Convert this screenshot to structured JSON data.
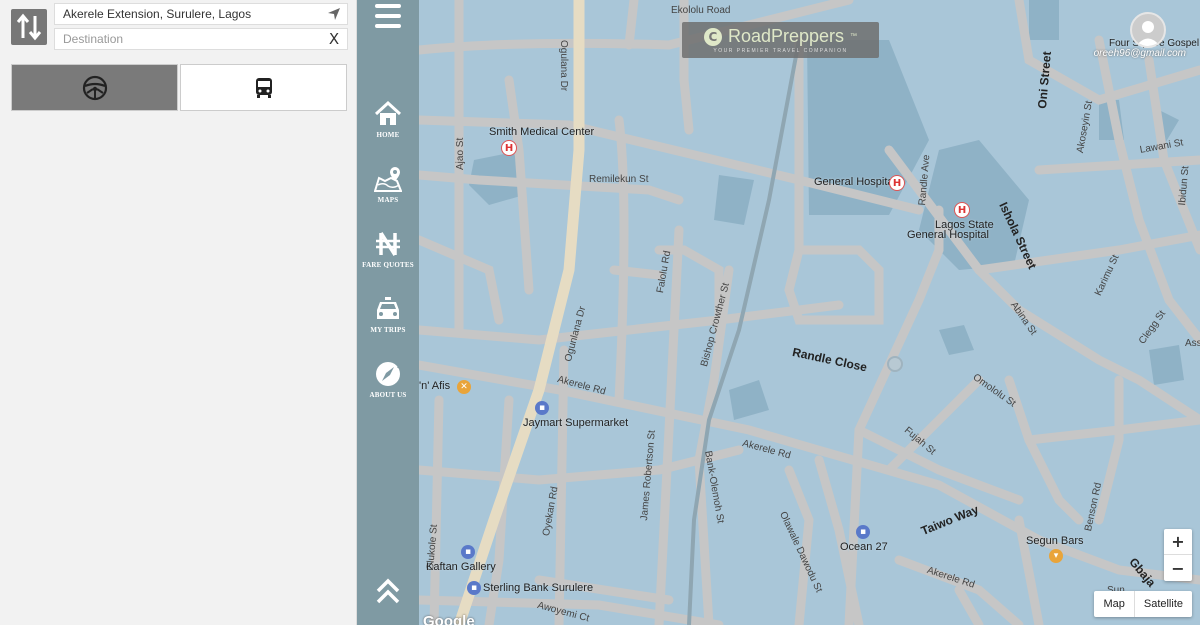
{
  "route": {
    "origin_value": "Akerele Extension, Surulere, Lagos",
    "destination_placeholder": "Destination",
    "clear_label": "X"
  },
  "modes": [
    {
      "icon": "steering-wheel-icon",
      "active": true
    },
    {
      "icon": "bus-icon",
      "active": false
    }
  ],
  "nav": {
    "items": [
      {
        "label": "HOME",
        "icon": "home-icon"
      },
      {
        "label": "MAPS",
        "icon": "map-pin-icon"
      },
      {
        "label": "FARE QUOTES",
        "icon": "naira-icon"
      },
      {
        "label": "MY TRIPS",
        "icon": "taxi-icon"
      },
      {
        "label": "ABOUT US",
        "icon": "compass-logo-icon"
      }
    ]
  },
  "brand": {
    "name": "RoadPreppers",
    "trademark": "™",
    "tagline": "YOUR PREMIER TRAVEL COMPANION"
  },
  "user": {
    "email": "oreeh96@gmail.com"
  },
  "map": {
    "pois": [
      {
        "label": "Smith Medical Center",
        "kind": "hospital"
      },
      {
        "label": "General Hospital",
        "kind": "hospital"
      },
      {
        "label": "Lagos State",
        "kind": "hospital"
      },
      {
        "label": "General Hospital",
        "kind": "hospital-line2"
      },
      {
        "label": "'n' Afis",
        "kind": "restaurant"
      },
      {
        "label": "Jaymart Supermarket",
        "kind": "shop"
      },
      {
        "label": "Ocean 27",
        "kind": "place"
      },
      {
        "label": "Kaftan Gallery",
        "kind": "shop"
      },
      {
        "label": "Sterling Bank Surulere",
        "kind": "bank"
      },
      {
        "label": "Segun Bars",
        "kind": "bar"
      },
      {
        "label": "Four Square Gospel Church",
        "kind": "church"
      }
    ],
    "streets": [
      "Ekololu Road",
      "Ogulana Dr",
      "Ogunlana Dr",
      "Remilekun St",
      "Ajao St",
      "Falolu Rd",
      "Bishop Crowther St",
      "Randle Ave",
      "Randle Close",
      "Ishola Street",
      "Oni Street",
      "Akoseyin St",
      "Lawani St",
      "Ibidun St",
      "Abina St",
      "Karimu St",
      "Clegg St",
      "Omololu St",
      "Akerele Rd",
      "Fujah St",
      "Taiwo Way",
      "Benson Rd",
      "James Robertson St",
      "Bank-Olemoh St",
      "Olawale Dawodu St",
      "Oyekan Rd",
      "Olukole St",
      "Awoyemi Ct",
      "Gbaja",
      "Ass",
      "Sun"
    ],
    "zoom_in": "+",
    "zoom_out": "−",
    "type_map": "Map",
    "type_satellite": "Satellite",
    "attribution": "Google"
  },
  "colors": {
    "map_water": "#a9c6d8",
    "rail": "#7f9aa3",
    "road": "#c8c8c8",
    "major_road": "#e6dcc3",
    "hospital": "#d33333"
  }
}
